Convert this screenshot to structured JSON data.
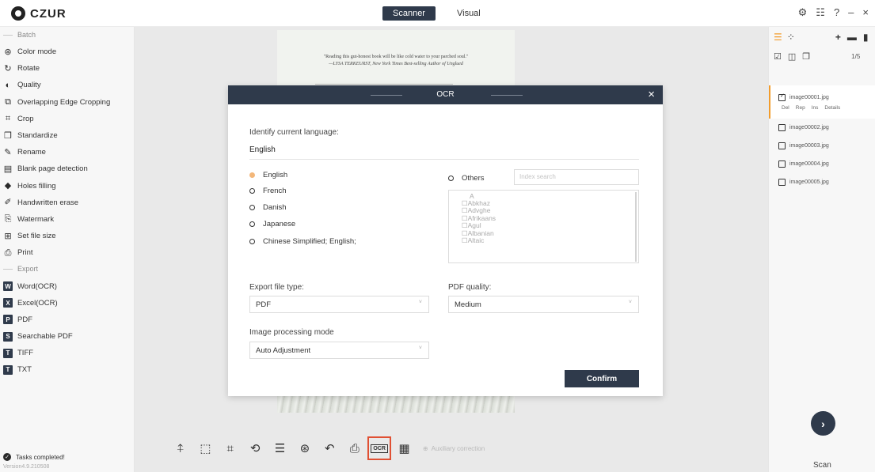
{
  "app": {
    "brand": "CZUR"
  },
  "modes": {
    "scanner": "Scanner",
    "visual": "Visual"
  },
  "window": {
    "settings": "⚙",
    "chat": "☷",
    "help": "?",
    "min": "–",
    "close": "×"
  },
  "sidebar": {
    "batch_header": "Batch",
    "batch_items": [
      {
        "label": "Color mode",
        "icon": "palette-icon"
      },
      {
        "label": "Rotate",
        "icon": "rotate-icon"
      },
      {
        "label": "Quality",
        "icon": "quality-icon"
      },
      {
        "label": "Overlapping Edge Cropping",
        "icon": "overlap-crop-icon"
      },
      {
        "label": "Crop",
        "icon": "crop-icon"
      },
      {
        "label": "Standardize",
        "icon": "standardize-icon"
      },
      {
        "label": "Rename",
        "icon": "rename-icon"
      },
      {
        "label": "Blank page detection",
        "icon": "blank-page-icon"
      },
      {
        "label": "Holes filling",
        "icon": "fill-icon"
      },
      {
        "label": "Handwritten erase",
        "icon": "erase-icon"
      },
      {
        "label": "Watermark",
        "icon": "watermark-icon"
      },
      {
        "label": "Set file size",
        "icon": "file-size-icon"
      },
      {
        "label": "Print",
        "icon": "print-icon"
      }
    ],
    "export_header": "Export",
    "export_items": [
      {
        "label": "Word(OCR)",
        "badge": "W"
      },
      {
        "label": "Excel(OCR)",
        "badge": "X"
      },
      {
        "label": "PDF",
        "badge": "P"
      },
      {
        "label": "Searchable PDF",
        "badge": "S"
      },
      {
        "label": "TIFF",
        "badge": "T"
      },
      {
        "label": "TXT",
        "badge": "T"
      }
    ],
    "tasks_status": "Tasks completed!",
    "version": "Version4.9.210508"
  },
  "document": {
    "quote_line1": "\"Reading this gut-honest book will be like cold water to your parched soul.\"",
    "quote_line2": "—LYSA TERKEURST, New York Times Best-selling Author of Unglued"
  },
  "dialog": {
    "title": "OCR",
    "identify_label": "Identify current language:",
    "current_language": "English",
    "languages": [
      "English",
      "French",
      "Danish",
      "Japanese",
      "Chinese Simplified; English;"
    ],
    "selected_language": "English",
    "others_label": "Others",
    "index_search_placeholder": "Index search",
    "others_alpha": "A",
    "others_options": [
      "Abkhaz",
      "Advghe",
      "Afrikaans",
      "Agul",
      "Albanian",
      "Altaic"
    ],
    "export_type_label": "Export file type:",
    "export_type_value": "PDF",
    "pdf_quality_label": "PDF quality:",
    "pdf_quality_value": "Medium",
    "processing_label": "Image processing mode",
    "processing_value": "Auto Adjustment",
    "confirm_label": "Confirm"
  },
  "toolbar": {
    "tools": [
      "split-icon",
      "select-area-icon",
      "crop-icon",
      "rotate-crop-icon",
      "adjust-icon",
      "color-icon",
      "undo-icon",
      "print-icon",
      "ocr-icon",
      "qr-icon"
    ],
    "ocr_label": "OCR",
    "auxiliary": "Auxiliary correction"
  },
  "right_panel": {
    "count": "1/5",
    "files": [
      {
        "name": "image00001.jpg",
        "checked": true,
        "selected": true
      },
      {
        "name": "image00002.jpg",
        "checked": false,
        "selected": false
      },
      {
        "name": "image00003.jpg",
        "checked": false,
        "selected": false
      },
      {
        "name": "image00004.jpg",
        "checked": false,
        "selected": false
      },
      {
        "name": "image00005.jpg",
        "checked": false,
        "selected": false
      }
    ],
    "file_actions": [
      "Del",
      "Rep",
      "Ins",
      "Details"
    ],
    "scan_label": "Scan"
  },
  "colors": {
    "accent": "#f39c2b",
    "dark": "#2f3a4b",
    "highlight": "#e05033"
  }
}
